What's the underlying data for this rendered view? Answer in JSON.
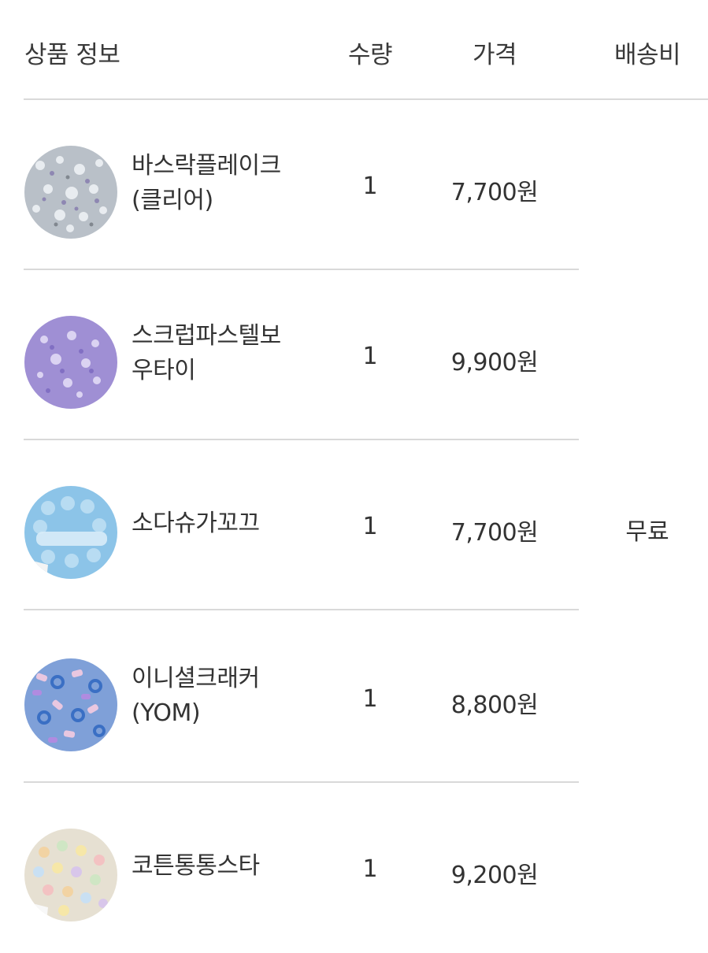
{
  "header": {
    "product_info": "상품 정보",
    "quantity": "수량",
    "price": "가격",
    "shipping": "배송비"
  },
  "shipping_fee": "무료",
  "items": [
    {
      "name_line1": "바스락플레이크",
      "name_line2": "(클리어)",
      "quantity": "1",
      "price": "7,700원",
      "thumb_color": "#c9cfd6"
    },
    {
      "name_line1": "스크럽파스텔보",
      "name_line2": "우타이",
      "quantity": "1",
      "price": "9,900원",
      "thumb_color": "#a595d8"
    },
    {
      "name_line1": "소다슈가꼬끄",
      "name_line2": "",
      "quantity": "1",
      "price": "7,700원",
      "thumb_color": "#8fc3e6"
    },
    {
      "name_line1": "이니셜크래커",
      "name_line2": "(YOM)",
      "quantity": "1",
      "price": "8,800원",
      "thumb_color": "#6a8fd0"
    },
    {
      "name_line1": "코튼통통스타",
      "name_line2": "",
      "quantity": "1",
      "price": "9,200원",
      "thumb_color": "#e8e2d6"
    }
  ]
}
